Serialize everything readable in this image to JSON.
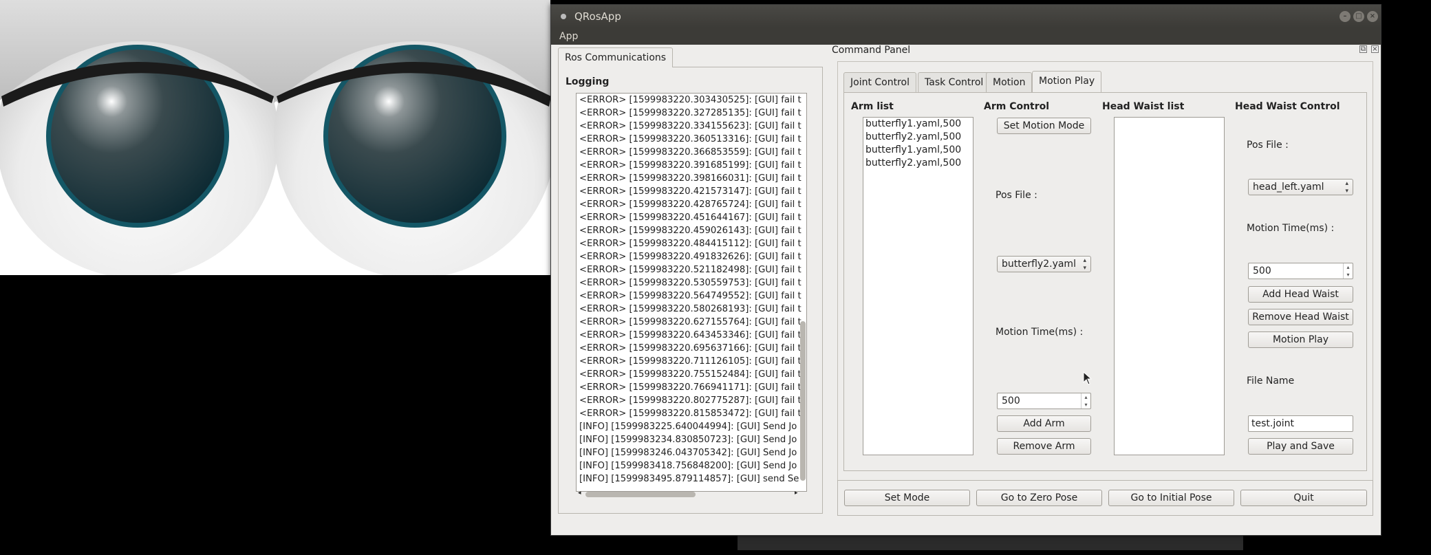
{
  "window": {
    "title": "QRosApp"
  },
  "menu": {
    "app": "App"
  },
  "ros": {
    "tab": "Ros Communications",
    "logging_label": "Logging",
    "log_lines": [
      "<ERROR> [1599983220.303430525]: [GUI] fail t",
      "<ERROR> [1599983220.327285135]: [GUI] fail t",
      "<ERROR> [1599983220.334155623]: [GUI] fail t",
      "<ERROR> [1599983220.360513316]: [GUI] fail t",
      "<ERROR> [1599983220.366853559]: [GUI] fail t",
      "<ERROR> [1599983220.391685199]: [GUI] fail t",
      "<ERROR> [1599983220.398166031]: [GUI] fail t",
      "<ERROR> [1599983220.421573147]: [GUI] fail t",
      "<ERROR> [1599983220.428765724]: [GUI] fail t",
      "<ERROR> [1599983220.451644167]: [GUI] fail t",
      "<ERROR> [1599983220.459026143]: [GUI] fail t",
      "<ERROR> [1599983220.484415112]: [GUI] fail t",
      "<ERROR> [1599983220.491832626]: [GUI] fail t",
      "<ERROR> [1599983220.521182498]: [GUI] fail t",
      "<ERROR> [1599983220.530559753]: [GUI] fail t",
      "<ERROR> [1599983220.564749552]: [GUI] fail t",
      "<ERROR> [1599983220.580268193]: [GUI] fail t",
      "<ERROR> [1599983220.627155764]: [GUI] fail t",
      "<ERROR> [1599983220.643453346]: [GUI] fail t",
      "<ERROR> [1599983220.695637166]: [GUI] fail t",
      "<ERROR> [1599983220.711126105]: [GUI] fail t",
      "<ERROR> [1599983220.755152484]: [GUI] fail t",
      "<ERROR> [1599983220.766941171]: [GUI] fail t",
      "<ERROR> [1599983220.802775287]: [GUI] fail t",
      "<ERROR> [1599983220.815853472]: [GUI] fail t",
      "[INFO] [1599983225.640044994]: [GUI] Send Jo",
      "[INFO] [1599983234.830850723]: [GUI] Send Jo",
      "[INFO] [1599983246.043705342]: [GUI] Send Jo",
      "[INFO] [1599983418.756848200]: [GUI] Send Jo",
      "[INFO] [1599983495.879114857]: [GUI] send Se"
    ]
  },
  "command_panel": {
    "title": "Command Panel",
    "tabs": [
      "Joint Control",
      "Task Control",
      "Motion",
      "Motion Play"
    ],
    "arm_list": {
      "label": "Arm list",
      "items": [
        "butterfly1.yaml,500",
        "butterfly2.yaml,500",
        "butterfly1.yaml,500",
        "butterfly2.yaml,500"
      ]
    },
    "arm_control": {
      "label": "Arm Control",
      "set_motion_mode": "Set Motion Mode",
      "pos_file_label": "Pos File :",
      "pos_file_value": "butterfly2.yaml",
      "motion_time_label": "Motion Time(ms) :",
      "motion_time_value": "500",
      "add_arm": "Add Arm",
      "remove_arm": "Remove Arm"
    },
    "head_waist_list": {
      "label": "Head Waist list"
    },
    "head_waist_control": {
      "label": "Head Waist Control",
      "pos_file_label": "Pos File :",
      "pos_file_value": "head_left.yaml",
      "motion_time_label": "Motion Time(ms) :",
      "motion_time_value": "500",
      "add_head_waist": "Add Head Waist",
      "remove_head_waist": "Remove Head Waist",
      "motion_play": "Motion Play",
      "file_name_label": "File Name",
      "file_name_value": "test.joint",
      "play_and_save": "Play and Save"
    },
    "bottom": {
      "set_mode": "Set Mode",
      "zero_pose": "Go to Zero Pose",
      "initial_pose": "Go to Initial Pose",
      "quit": "Quit"
    }
  }
}
